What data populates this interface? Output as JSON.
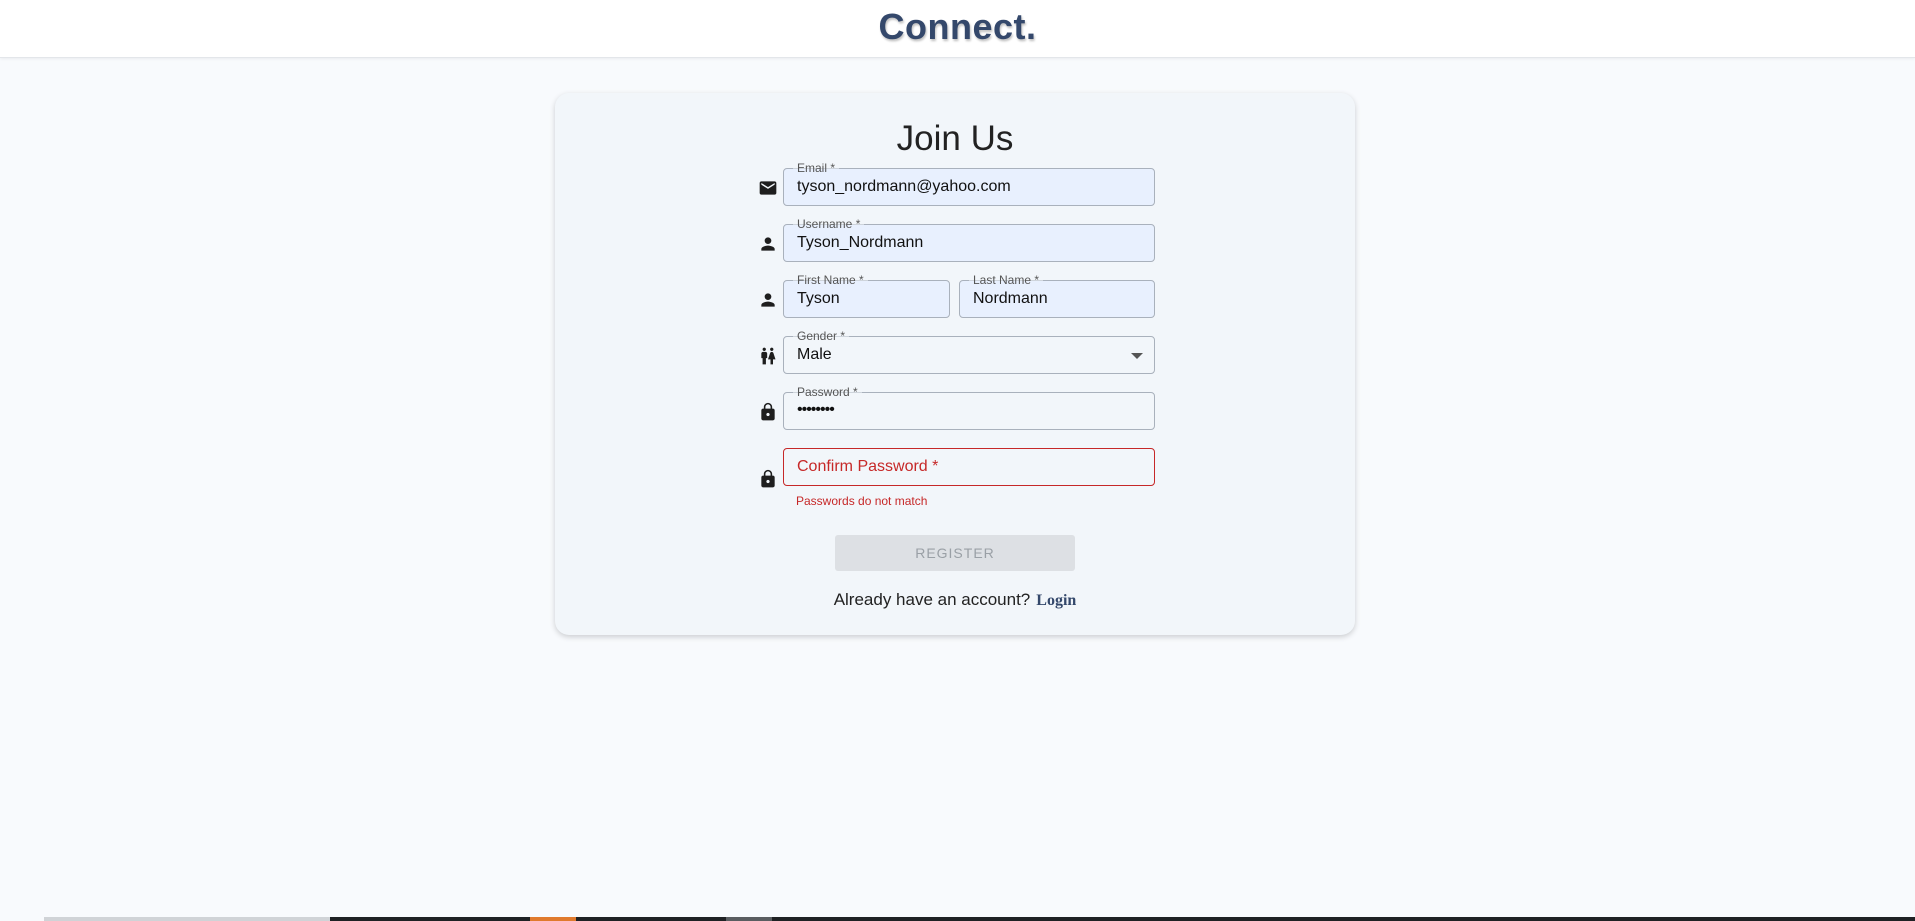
{
  "header": {
    "brand": "Connect."
  },
  "form": {
    "title": "Join Us",
    "email": {
      "label": "Email *",
      "value": "tyson_nordmann@yahoo.com"
    },
    "username": {
      "label": "Username *",
      "value": "Tyson_Nordmann"
    },
    "first_name": {
      "label": "First Name *",
      "value": "Tyson"
    },
    "last_name": {
      "label": "Last Name *",
      "value": "Nordmann"
    },
    "gender": {
      "label": "Gender *",
      "value": "Male"
    },
    "password": {
      "label": "Password *",
      "value": "••••••••"
    },
    "confirm_password": {
      "placeholder": "Confirm Password *",
      "error": "Passwords do not match"
    },
    "register_label": "REGISTER",
    "footer_text": "Already have an account?",
    "login_label": "Login"
  },
  "icons": {
    "email": "mail-icon",
    "username": "person-icon",
    "name": "person-icon",
    "gender": "wc-icon",
    "password": "lock-icon",
    "confirm_password": "lock-icon"
  },
  "colors": {
    "brand": "#34486b",
    "error": "#c62828",
    "autofill_bg": "#e8f0fe",
    "disabled_button": "#dde0e4"
  }
}
